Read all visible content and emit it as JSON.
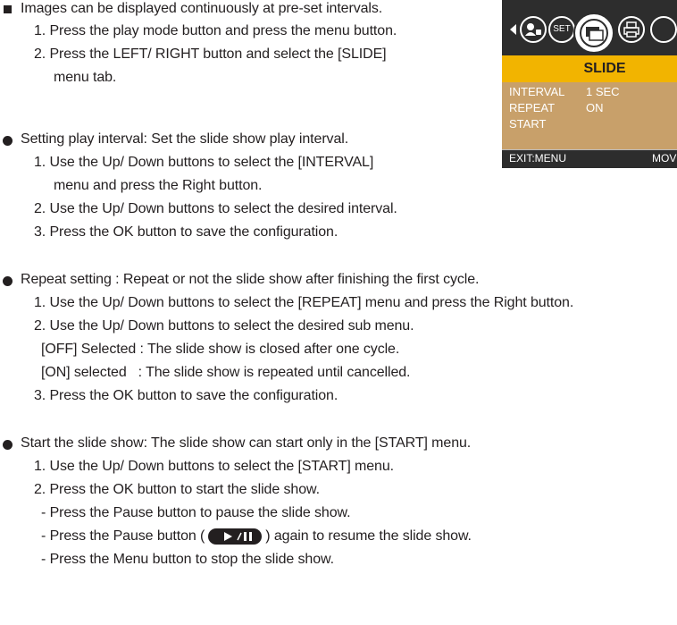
{
  "section1": {
    "line1": "Images can be displayed continuously at pre-set intervals.",
    "line2": "1. Press the play mode button and press the menu button.",
    "line3": "2. Press the LEFT/ RIGHT button and select the [SLIDE]",
    "line4": "menu tab."
  },
  "lcd": {
    "icon_set": "SET",
    "title": "SLIDE",
    "rows": [
      {
        "label": "INTERVAL",
        "value": "1 SEC"
      },
      {
        "label": "REPEAT",
        "value": "ON"
      },
      {
        "label": "START",
        "value": ""
      }
    ],
    "exit": "EXIT:MENU",
    "move": "MOVE"
  },
  "section2": {
    "line1": "Setting play interval: Set the slide show play interval.",
    "line2": "1. Use the Up/ Down buttons to select the [INTERVAL]",
    "line3": "menu and press the Right button.",
    "line4": "2. Use the Up/ Down buttons to select the desired interval.",
    "line5": "3. Press the OK button to save the configuration."
  },
  "section3": {
    "line1": "Repeat setting : Repeat or not the slide show after finishing the first cycle.",
    "line2": "1. Use the Up/ Down buttons to select the [REPEAT] menu and press the Right button.",
    "line3": "2. Use the Up/ Down buttons to select the desired sub menu.",
    "line4": "[OFF] Selected : The slide show is closed after one cycle.",
    "line5": "[ON] selected   : The slide show is repeated until cancelled.",
    "line6": "3. Press the OK button to save the configuration."
  },
  "section4": {
    "line1": "Start the slide show: The slide show can start only in the [START] menu.",
    "line2": "1. Use the Up/ Down buttons to select the [START] menu.",
    "line3": "2. Press the OK button to start the slide show.",
    "line4": "- Press the Pause button to pause the slide show.",
    "line5a": "- Press the Pause button (",
    "line5b": ") again to resume the slide show.",
    "line6": "- Press the Menu button to stop the slide show."
  },
  "colors": {
    "lcd_bg": "#2d2d2d",
    "title_bar": "#f2b400",
    "menu_bg": "#c8a06a",
    "text": "#231f20"
  },
  "icons": [
    "square-bullet-icon",
    "round-bullet-icon",
    "left-arrow-icon",
    "person-icon",
    "set-icon",
    "slideshow-icon",
    "print-icon",
    "play-pause-icon"
  ]
}
